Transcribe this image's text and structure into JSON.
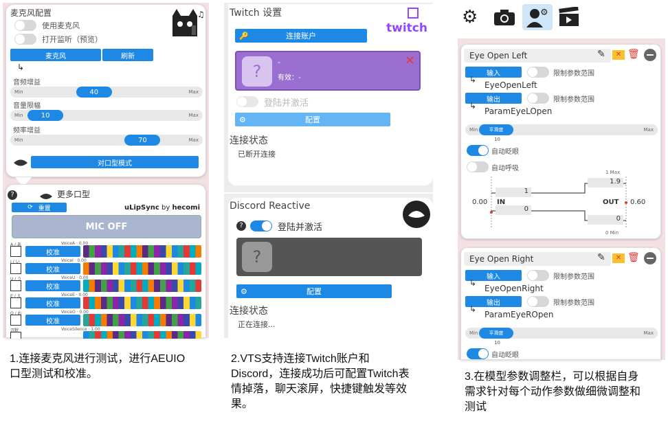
{
  "p1": {
    "title": "麦克风配置",
    "use_mic": "使用麦克风",
    "monitor": "打开监听（预览）",
    "mic_btn": "麦克风",
    "refresh_btn": "刷新",
    "gain": "音频增益",
    "gain_val": "40",
    "gain_pct": 0.42,
    "limit": "音量限幅",
    "limit_val": "10",
    "limit_pct": 0.11,
    "freq": "频率增益",
    "freq_val": "70",
    "freq_pct": 0.73,
    "min": "Min",
    "max": "Max",
    "lip_btn": "对口型模式",
    "more": "更多口型",
    "reset": "重置",
    "brand": "uLipSync",
    "by": " by ",
    "author": "hecomi",
    "mic_off": "MIC OFF",
    "rows": [
      {
        "k": "A / あ",
        "v": "VoiceA · 0.00",
        "b": "校准"
      },
      {
        "k": "I / い",
        "v": "VoiceI · 0.00",
        "b": "校准"
      },
      {
        "k": "U / う",
        "v": "VoiceU · 0.00",
        "b": "校准"
      },
      {
        "k": "E / え",
        "v": "VoiceE · 0.00",
        "b": "校准"
      },
      {
        "k": "O / お",
        "v": "VoiceO · 0.00",
        "b": "校准"
      },
      {
        "k": "沉默",
        "v": "VoiceSilence · 1.00",
        "b": ""
      }
    ]
  },
  "p2": {
    "title": "Twitch 设置",
    "logo": "twitch",
    "connect": "连接账户",
    "acct_name": "-",
    "acct_valid": "有效：-",
    "login": "登陆并激活",
    "config": "配置",
    "status_h": "连接状态",
    "status": "已断开连接",
    "d_title": "Discord Reactive",
    "d_login": "登陆并激活",
    "d_config": "配置",
    "d_status_h": "连接状态",
    "d_status": "正在连接..."
  },
  "p3": {
    "blocks": [
      {
        "name": "Eye Open Left",
        "in": "输入",
        "in_lim": "限制参数范围",
        "in_param": "EyeOpenLeft",
        "out": "输出",
        "out_lim": "限制参数范围",
        "out_param": "ParamEyeLOpen",
        "smooth": "平滑度",
        "smooth_val": "10",
        "auto_blink": "自动眨眼",
        "auto_breath": "自动呼吸",
        "in_max": "1",
        "in_min": "0",
        "out_max": "1.9",
        "out_min": "0",
        "max_lbl": "1 Max",
        "min_lbl": "0 Min",
        "in_lbl": "IN",
        "out_lbl": "OUT",
        "in_val": "0.00",
        "out_val": "0.60",
        "min": "Min",
        "max": "Max"
      },
      {
        "name": "Eye Open Right",
        "in": "输入",
        "in_lim": "限制参数范围",
        "in_param": "EyeOpenRight",
        "out": "输出",
        "out_lim": "限制参数范围",
        "out_param": "ParamEyeROpen",
        "smooth": "平滑度",
        "smooth_val": "10",
        "auto_blink": "自动眨眼",
        "min": "Min",
        "max": "Max"
      }
    ]
  },
  "captions": {
    "c1": "1.连接麦克风进行测试，进行AEUIO口型测试和校准。",
    "c2": "2.VTS支持连接Twitch账户和Discord，连接成功后可配置Twitch表情掉落，聊天滚屏，快捷键触发等效果。",
    "c3": "3.在模型参数调整栏，可以根据自身 需求针对每个动作参数做细微调整和测试"
  },
  "colors": {
    "accent": "#1e88e5",
    "twitch": "#9147ff",
    "panel_pink": "#f3e0e3",
    "panel_gray": "#ececec"
  }
}
